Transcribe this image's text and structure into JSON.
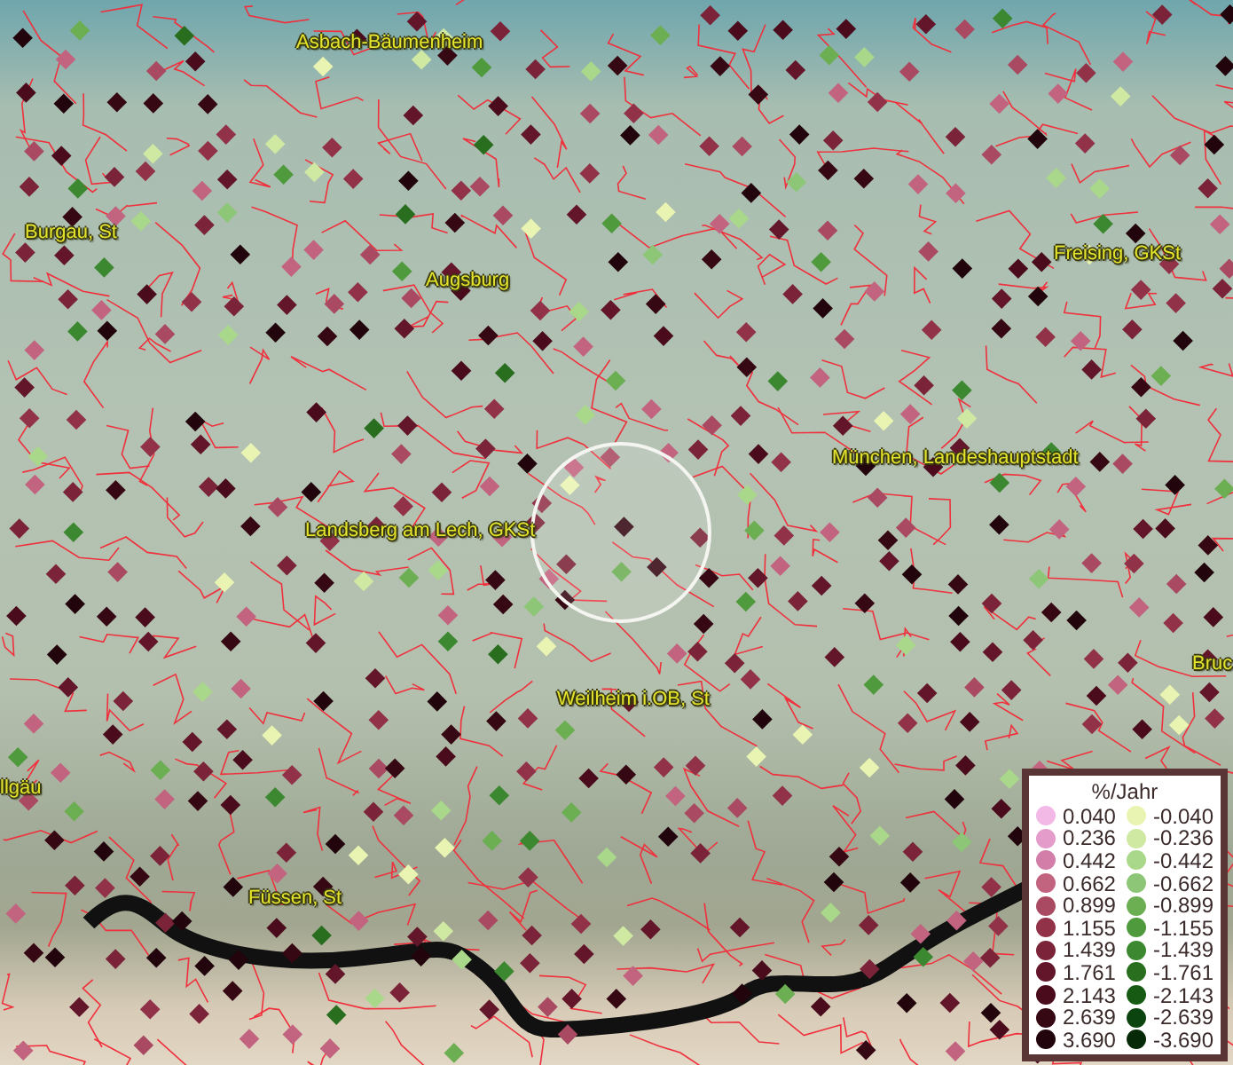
{
  "map": {
    "place_labels": [
      {
        "text": "Asbach-Bäumenheim"
      },
      {
        "text": "Burgau, St"
      },
      {
        "text": "Augsburg"
      },
      {
        "text": "Freising, GKSt"
      },
      {
        "text": "München, Landeshauptstadt"
      },
      {
        "text": "Landsberg am Lech, GKSt"
      },
      {
        "text": "Weilheim i.OB, St"
      },
      {
        "text": "llgäu"
      },
      {
        "text": "Füssen, St"
      },
      {
        "text": "Bruc"
      }
    ]
  },
  "legend": {
    "title": "%/Jahr",
    "columns": [
      [
        {
          "value": "0.040",
          "color": "#f2b8e6"
        },
        {
          "value": "0.236",
          "color": "#e49ccb"
        },
        {
          "value": "0.442",
          "color": "#d27ea8"
        },
        {
          "value": "0.662",
          "color": "#c2637f"
        },
        {
          "value": "0.899",
          "color": "#a94a62"
        },
        {
          "value": "1.155",
          "color": "#913249"
        },
        {
          "value": "1.439",
          "color": "#7b2338"
        },
        {
          "value": "1.761",
          "color": "#63162a"
        },
        {
          "value": "2.143",
          "color": "#4a0c1c"
        },
        {
          "value": "2.639",
          "color": "#360814"
        },
        {
          "value": "3.690",
          "color": "#22040c"
        }
      ],
      [
        {
          "value": "-0.040",
          "color": "#eaf4b2"
        },
        {
          "value": "-0.236",
          "color": "#cfe8a2"
        },
        {
          "value": "-0.442",
          "color": "#aad88a"
        },
        {
          "value": "-0.662",
          "color": "#8cc676"
        },
        {
          "value": "-0.899",
          "color": "#6cae52"
        },
        {
          "value": "-1.155",
          "color": "#4f9a3c"
        },
        {
          "value": "-1.439",
          "color": "#3c8830"
        },
        {
          "value": "-1.761",
          "color": "#286e1e"
        },
        {
          "value": "-2.143",
          "color": "#175a14"
        },
        {
          "value": "-2.639",
          "color": "#0c4410"
        },
        {
          "value": "-3.690",
          "color": "#062a08"
        }
      ]
    ]
  }
}
